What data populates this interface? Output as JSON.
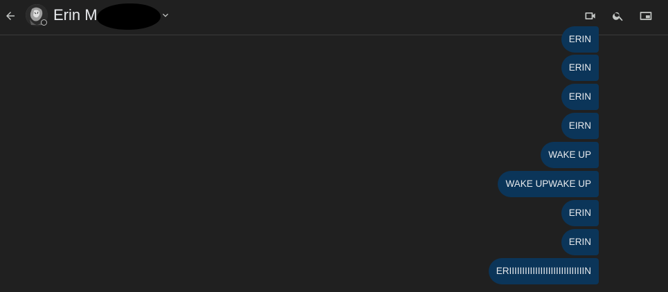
{
  "header": {
    "contact_name": "Erin M",
    "icons": {
      "back": "arrow-back-icon",
      "expand": "chevron-down-icon",
      "video": "video-call-icon",
      "search": "search-icon",
      "pip": "picture-in-picture-icon"
    }
  },
  "messages": [
    {
      "text": "ERIN"
    },
    {
      "text": "ERIN"
    },
    {
      "text": "ERIN"
    },
    {
      "text": "EIRN"
    },
    {
      "text": "WAKE UP"
    },
    {
      "text": "WAKE UPWAKE UP"
    },
    {
      "text": "ERIN"
    },
    {
      "text": "ERIN"
    },
    {
      "text": "ERIIIIIIIIIIIIIIIIIIIIIIIIIIIIIN"
    }
  ],
  "colors": {
    "background": "#202020",
    "bubble": "#0b3559",
    "text": "#e8eaed"
  }
}
